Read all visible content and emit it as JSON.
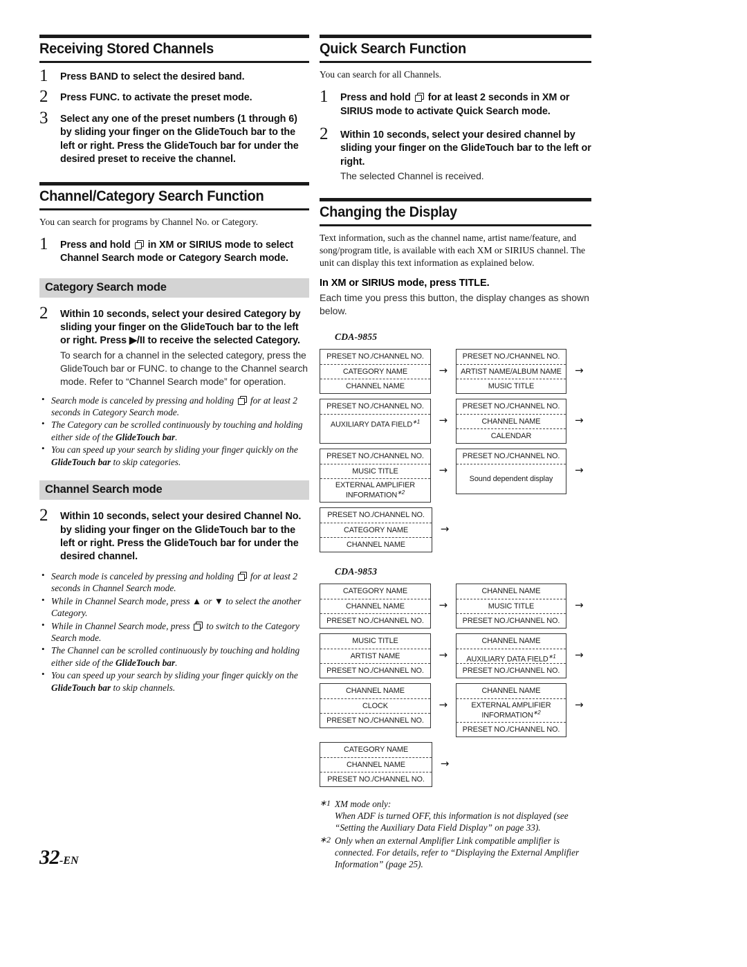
{
  "page": {
    "number_label": "32",
    "lang_suffix": "-EN"
  },
  "left_column": {
    "section1": {
      "title": "Receiving Stored Channels",
      "steps": [
        {
          "num": "1",
          "html": "Press <b>BAND</b> to select the desired band."
        },
        {
          "num": "2",
          "html": "Press <b>FUNC.</b> to activate the preset mode."
        },
        {
          "num": "3",
          "html": "Select any one of the preset numbers (1 through 6) by sliding your finger on the <b>GlideTouch bar</b> to the left or right. Press the <b>GlideTouch bar</b> for under the desired preset to receive the channel."
        }
      ]
    },
    "section2": {
      "title": "Channel/Category Search Function",
      "intro": "You can search for programs by Channel No. or Category.",
      "step1": {
        "num": "1",
        "html": "Press and hold <i class=\"ico\" data-name=\"band-stack-icon\"></i> in XM or SIRIUS mode to select Channel Search mode or Category Search mode."
      },
      "category_bar": "Category Search mode",
      "category_step": {
        "num": "2",
        "html": "Within 10 seconds, select your desired Category by sliding your finger on the <b>GlideTouch bar</b> to the left or right. Press &#9654;/&#73;&#73; to receive the selected Category.",
        "sub": "To search for a channel in the selected category, press the GlideTouch bar or FUNC. to change to the Channel search mode. Refer to “Channel Search mode” for operation."
      },
      "category_notes": [
        "Search mode is canceled by pressing and holding <i class=\"ico\"></i> for at least 2 seconds in Category Search mode.",
        "The Category can be scrolled continuously by touching and holding either side of the <b>GlideTouch bar</b>.",
        "You can speed up your search by sliding your finger quickly on the <b>GlideTouch bar</b> to skip categories."
      ],
      "channel_bar": "Channel Search mode",
      "channel_step": {
        "num": "2",
        "html": "Within 10 seconds, select your desired Channel No. by sliding your finger on the <b>GlideTouch bar</b> to the left or right. Press the <b>GlideTouch bar</b> for under the desired channel."
      },
      "channel_notes": [
        "Search mode is canceled by pressing and holding <i class=\"ico\"></i> for at least 2 seconds in Channel Search mode.",
        "While in Channel Search mode, press &#9650; or &#9660; to select the another Category.",
        "While in Channel Search mode, press <i class=\"ico\"></i> to switch to the Category Search mode.",
        "The Channel can be scrolled continuously by touching and holding either side of the <b>GlideTouch bar</b>.",
        "You can speed up your search by sliding your finger quickly on the <b>GlideTouch bar</b> to skip channels."
      ]
    }
  },
  "right_column": {
    "section1": {
      "title": "Quick Search Function",
      "intro": "You can search for all Channels.",
      "steps": [
        {
          "num": "1",
          "html": "Press and hold <i class=\"ico\" data-name=\"band-stack-icon\"></i> for at least 2 seconds in XM or SIRIUS mode to activate Quick Search mode."
        },
        {
          "num": "2",
          "html": "Within 10 seconds, select your desired channel by sliding your finger on the <b>GlideTouch bar</b> to the left or right.",
          "sub": "The selected Channel is received."
        }
      ]
    },
    "section2": {
      "title": "Changing the Display",
      "intro": "Text information, such as the channel name, artist name/feature, and song/program title, is available with each XM or SIRIUS channel. The unit can display this text information as explained below.",
      "bold_line_html": "In XM or SIRIUS mode, press <b>TITLE</b>.",
      "after_bold": "Each time you press this button, the display changes as shown below.",
      "model_9855": "CDA-9855",
      "model_9853": "CDA-9853",
      "arrow_glyph": "→"
    },
    "footnotes": [
      {
        "mark": "*1",
        "lines": [
          "XM mode only:",
          "When ADF is turned OFF, this information is not displayed (see",
          "“Setting the Auxiliary Data Field Display” on page 33)."
        ]
      },
      {
        "mark": "*2",
        "lines": [
          "Only when an external Amplifier Link compatible amplifier is",
          "connected. For details, refer to “Displaying the External Amplifier",
          "Information” (page 25)."
        ]
      }
    ]
  },
  "diagram_9855": {
    "rows": [
      {
        "boxes": [
          {
            "lines": [
              "PRESET NO./CHANNEL NO.",
              "CATEGORY NAME",
              "CHANNEL NAME"
            ]
          },
          {
            "lines": [
              "PRESET NO./CHANNEL NO.",
              "ARTIST NAME/ALBUM NAME",
              "MUSIC TITLE"
            ]
          }
        ]
      },
      {
        "boxes": [
          {
            "lines": [
              "PRESET NO./CHANNEL NO.",
              "AUXILIARY DATA FIELD*1",
              ""
            ]
          },
          {
            "lines": [
              "PRESET NO./CHANNEL NO.",
              "CHANNEL NAME",
              "CALENDAR"
            ]
          }
        ]
      },
      {
        "boxes": [
          {
            "lines": [
              "PRESET NO./CHANNEL NO.",
              "MUSIC TITLE",
              "EXTERNAL AMPLIFIER INFORMATION*2"
            ]
          },
          {
            "lines": [
              "PRESET NO./CHANNEL NO.",
              "Sound dependent display"
            ]
          }
        ]
      },
      {
        "boxes": [
          {
            "lines": [
              "PRESET NO./CHANNEL NO.",
              "CATEGORY NAME",
              "CHANNEL NAME"
            ]
          }
        ]
      }
    ]
  },
  "diagram_9853": {
    "rows": [
      {
        "boxes": [
          {
            "lines": [
              "CATEGORY NAME",
              "CHANNEL NAME",
              "PRESET NO./CHANNEL NO."
            ]
          },
          {
            "lines": [
              "CHANNEL NAME",
              "MUSIC TITLE",
              "PRESET NO./CHANNEL NO."
            ]
          }
        ]
      },
      {
        "boxes": [
          {
            "lines": [
              "MUSIC TITLE",
              "ARTIST NAME",
              "PRESET NO./CHANNEL NO."
            ]
          },
          {
            "lines": [
              "CHANNEL NAME",
              "AUXILIARY DATA FIELD*1",
              "PRESET NO./CHANNEL NO."
            ]
          }
        ]
      },
      {
        "boxes": [
          {
            "lines": [
              "CHANNEL NAME",
              "CLOCK",
              "PRESET NO./CHANNEL NO."
            ]
          },
          {
            "lines": [
              "CHANNEL NAME",
              "EXTERNAL AMPLIFIER INFORMATION*2",
              "PRESET NO./CHANNEL NO."
            ]
          }
        ]
      },
      {
        "boxes": [
          {
            "lines": [
              "CATEGORY NAME",
              "CHANNEL NAME",
              "PRESET NO./CHANNEL NO."
            ]
          }
        ]
      }
    ]
  }
}
